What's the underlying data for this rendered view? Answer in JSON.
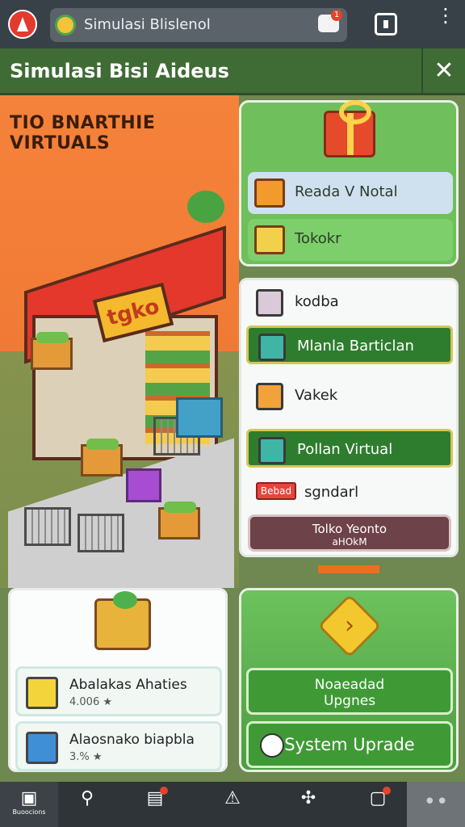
{
  "browser": {
    "url_text": "Simulasi Blislenol",
    "tab_badge": "1"
  },
  "header": {
    "title": "Simulasi  Bisi Aideus"
  },
  "hero": {
    "title": "TIO BNARTHIE VIRTUALS",
    "store_sign": "tgko"
  },
  "top_panel": {
    "items": [
      {
        "label": "Reada V Notal",
        "icon": "box-icon",
        "color": "#cfe1ef"
      },
      {
        "label": "Tokokr",
        "icon": "package-icon",
        "color": "#7dcf6b"
      }
    ]
  },
  "list_panel": {
    "rows": [
      {
        "label": "kodba",
        "style": "plain"
      },
      {
        "label": "Mlanla Barticlan",
        "style": "green"
      },
      {
        "label": "Vakek",
        "style": "plain"
      },
      {
        "label": "Pollan Virtual",
        "style": "green"
      }
    ],
    "badge_text": "Bebad",
    "badge_label": "sgndarl",
    "store_button_line1": "Tolko Yeonto",
    "store_button_line2": "aHOkM"
  },
  "progress": {
    "value": 1.0
  },
  "stats_panel": {
    "cards": [
      {
        "title": "Abalakas Ahaties",
        "value": "4.006 ★"
      },
      {
        "title": "Alaosnako biapbla",
        "value": "3.% ★"
      }
    ]
  },
  "upgrade_panel": {
    "button1_line1": "Noaeadad",
    "button1_line2": "Upgnes",
    "button2": "System Uprade"
  },
  "nav": {
    "items": [
      {
        "label": "Buoocions",
        "glyph": "▣"
      },
      {
        "label": "",
        "glyph": "⚲"
      },
      {
        "label": "",
        "glyph": "▤"
      },
      {
        "label": "",
        "glyph": "⚠"
      },
      {
        "label": "",
        "glyph": "✣"
      },
      {
        "label": "",
        "glyph": "▢"
      }
    ],
    "more": "••"
  }
}
